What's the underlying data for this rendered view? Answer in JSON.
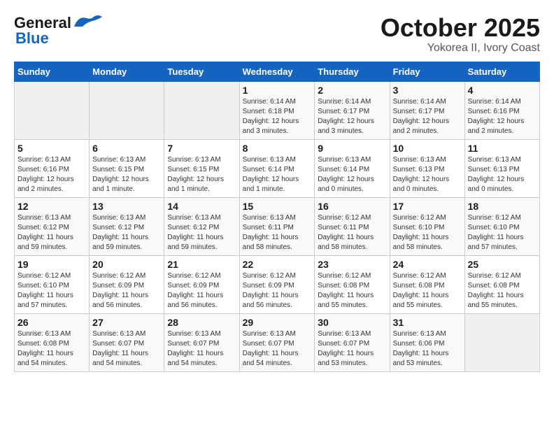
{
  "header": {
    "logo_line1": "General",
    "logo_line2": "Blue",
    "month_title": "October 2025",
    "location": "Yokorea II, Ivory Coast"
  },
  "weekdays": [
    "Sunday",
    "Monday",
    "Tuesday",
    "Wednesday",
    "Thursday",
    "Friday",
    "Saturday"
  ],
  "weeks": [
    [
      {
        "day": "",
        "info": ""
      },
      {
        "day": "",
        "info": ""
      },
      {
        "day": "",
        "info": ""
      },
      {
        "day": "1",
        "info": "Sunrise: 6:14 AM\nSunset: 6:18 PM\nDaylight: 12 hours and 3 minutes."
      },
      {
        "day": "2",
        "info": "Sunrise: 6:14 AM\nSunset: 6:17 PM\nDaylight: 12 hours and 3 minutes."
      },
      {
        "day": "3",
        "info": "Sunrise: 6:14 AM\nSunset: 6:17 PM\nDaylight: 12 hours and 2 minutes."
      },
      {
        "day": "4",
        "info": "Sunrise: 6:14 AM\nSunset: 6:16 PM\nDaylight: 12 hours and 2 minutes."
      }
    ],
    [
      {
        "day": "5",
        "info": "Sunrise: 6:13 AM\nSunset: 6:16 PM\nDaylight: 12 hours and 2 minutes."
      },
      {
        "day": "6",
        "info": "Sunrise: 6:13 AM\nSunset: 6:15 PM\nDaylight: 12 hours and 1 minute."
      },
      {
        "day": "7",
        "info": "Sunrise: 6:13 AM\nSunset: 6:15 PM\nDaylight: 12 hours and 1 minute."
      },
      {
        "day": "8",
        "info": "Sunrise: 6:13 AM\nSunset: 6:14 PM\nDaylight: 12 hours and 1 minute."
      },
      {
        "day": "9",
        "info": "Sunrise: 6:13 AM\nSunset: 6:14 PM\nDaylight: 12 hours and 0 minutes."
      },
      {
        "day": "10",
        "info": "Sunrise: 6:13 AM\nSunset: 6:13 PM\nDaylight: 12 hours and 0 minutes."
      },
      {
        "day": "11",
        "info": "Sunrise: 6:13 AM\nSunset: 6:13 PM\nDaylight: 12 hours and 0 minutes."
      }
    ],
    [
      {
        "day": "12",
        "info": "Sunrise: 6:13 AM\nSunset: 6:12 PM\nDaylight: 11 hours and 59 minutes."
      },
      {
        "day": "13",
        "info": "Sunrise: 6:13 AM\nSunset: 6:12 PM\nDaylight: 11 hours and 59 minutes."
      },
      {
        "day": "14",
        "info": "Sunrise: 6:13 AM\nSunset: 6:12 PM\nDaylight: 11 hours and 59 minutes."
      },
      {
        "day": "15",
        "info": "Sunrise: 6:13 AM\nSunset: 6:11 PM\nDaylight: 11 hours and 58 minutes."
      },
      {
        "day": "16",
        "info": "Sunrise: 6:12 AM\nSunset: 6:11 PM\nDaylight: 11 hours and 58 minutes."
      },
      {
        "day": "17",
        "info": "Sunrise: 6:12 AM\nSunset: 6:10 PM\nDaylight: 11 hours and 58 minutes."
      },
      {
        "day": "18",
        "info": "Sunrise: 6:12 AM\nSunset: 6:10 PM\nDaylight: 11 hours and 57 minutes."
      }
    ],
    [
      {
        "day": "19",
        "info": "Sunrise: 6:12 AM\nSunset: 6:10 PM\nDaylight: 11 hours and 57 minutes."
      },
      {
        "day": "20",
        "info": "Sunrise: 6:12 AM\nSunset: 6:09 PM\nDaylight: 11 hours and 56 minutes."
      },
      {
        "day": "21",
        "info": "Sunrise: 6:12 AM\nSunset: 6:09 PM\nDaylight: 11 hours and 56 minutes."
      },
      {
        "day": "22",
        "info": "Sunrise: 6:12 AM\nSunset: 6:09 PM\nDaylight: 11 hours and 56 minutes."
      },
      {
        "day": "23",
        "info": "Sunrise: 6:12 AM\nSunset: 6:08 PM\nDaylight: 11 hours and 55 minutes."
      },
      {
        "day": "24",
        "info": "Sunrise: 6:12 AM\nSunset: 6:08 PM\nDaylight: 11 hours and 55 minutes."
      },
      {
        "day": "25",
        "info": "Sunrise: 6:12 AM\nSunset: 6:08 PM\nDaylight: 11 hours and 55 minutes."
      }
    ],
    [
      {
        "day": "26",
        "info": "Sunrise: 6:13 AM\nSunset: 6:08 PM\nDaylight: 11 hours and 54 minutes."
      },
      {
        "day": "27",
        "info": "Sunrise: 6:13 AM\nSunset: 6:07 PM\nDaylight: 11 hours and 54 minutes."
      },
      {
        "day": "28",
        "info": "Sunrise: 6:13 AM\nSunset: 6:07 PM\nDaylight: 11 hours and 54 minutes."
      },
      {
        "day": "29",
        "info": "Sunrise: 6:13 AM\nSunset: 6:07 PM\nDaylight: 11 hours and 54 minutes."
      },
      {
        "day": "30",
        "info": "Sunrise: 6:13 AM\nSunset: 6:07 PM\nDaylight: 11 hours and 53 minutes."
      },
      {
        "day": "31",
        "info": "Sunrise: 6:13 AM\nSunset: 6:06 PM\nDaylight: 11 hours and 53 minutes."
      },
      {
        "day": "",
        "info": ""
      }
    ]
  ]
}
